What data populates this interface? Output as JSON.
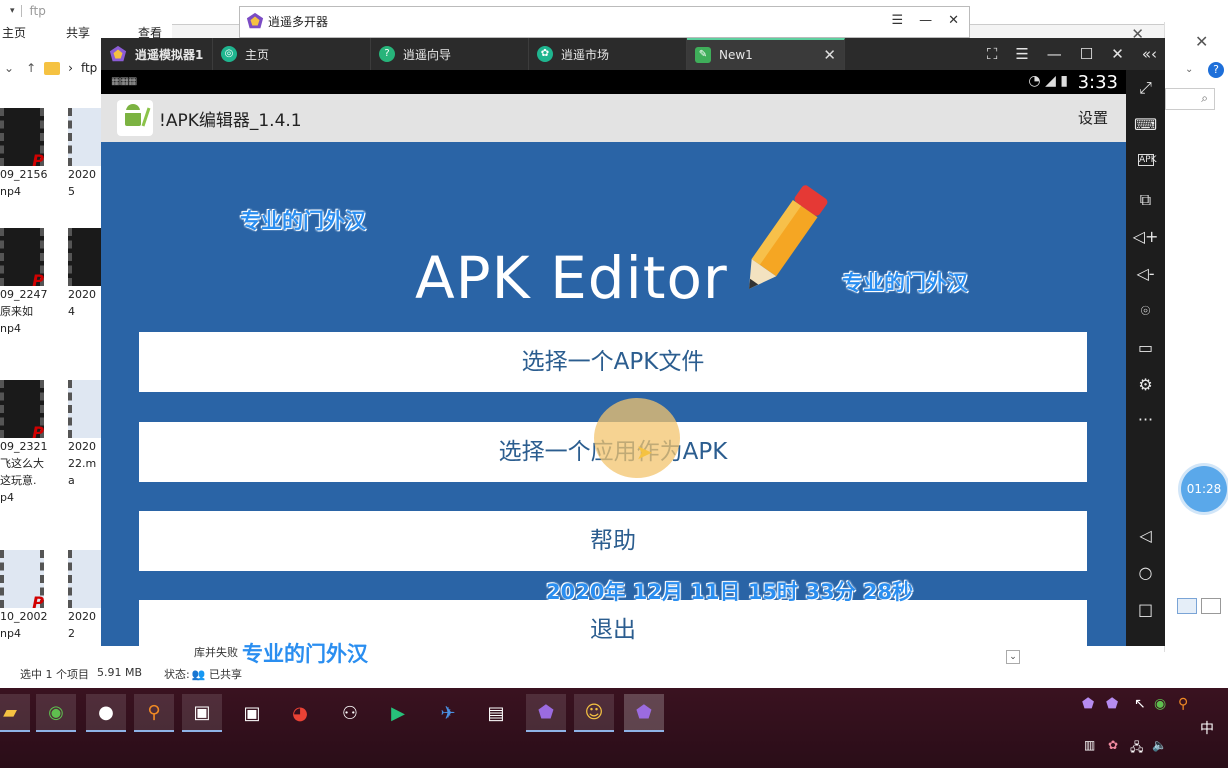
{
  "explorer": {
    "title": "ftp",
    "menu": [
      "主页",
      "共享",
      "查看"
    ],
    "address": "ftp",
    "files": [
      {
        "name": "09_2156\nnp4"
      },
      {
        "name": "2020\n5"
      },
      {
        "name": "09_2247\n原来如\nnp4"
      },
      {
        "name": "2020\n4"
      },
      {
        "name": "09_2321\n飞这么大\n这玩意.\np4"
      },
      {
        "name": "2020\n22.m\na"
      },
      {
        "name": "10_2002\nnp4"
      },
      {
        "name": "2020\n2"
      }
    ],
    "status_selected": "选中 1 个项目",
    "status_size": "5.91 MB",
    "status_state": "状态:",
    "status_shared": "已共享",
    "status_error": "库并失败"
  },
  "multi_opener": {
    "title": "逍遥多开器"
  },
  "emulator": {
    "tabs": [
      {
        "label": "逍遥模拟器1"
      },
      {
        "label": "主页"
      },
      {
        "label": "逍遥向导"
      },
      {
        "label": "逍遥市场"
      },
      {
        "label": "New1"
      }
    ],
    "status_time": "3:33",
    "app_title": "!APK编辑器_1.4.1",
    "settings_label": "设置",
    "banner": "APK Editor",
    "buttons": [
      {
        "label": "选择一个APK文件"
      },
      {
        "label": "选择一个应用作为APK"
      },
      {
        "label": "帮助"
      },
      {
        "label": "退出"
      }
    ],
    "side_icons": [
      "fullscreen-icon",
      "keyboard-icon",
      "apk-icon",
      "multi-window-icon",
      "volume-up-icon",
      "volume-down-icon",
      "location-icon",
      "folder-icon",
      "settings-icon",
      "more-icon",
      "back-icon",
      "home-icon",
      "recent-icon"
    ],
    "side_apk_label": "APK"
  },
  "watermarks": {
    "w1": "专业的门外汉",
    "w2": "专业的门外汉",
    "w3": "专业的门外汉",
    "datetime": "2020年 12月 11日 15时 33分 28秒"
  },
  "timer": "01:28",
  "taskbar": {
    "ime": "中"
  }
}
